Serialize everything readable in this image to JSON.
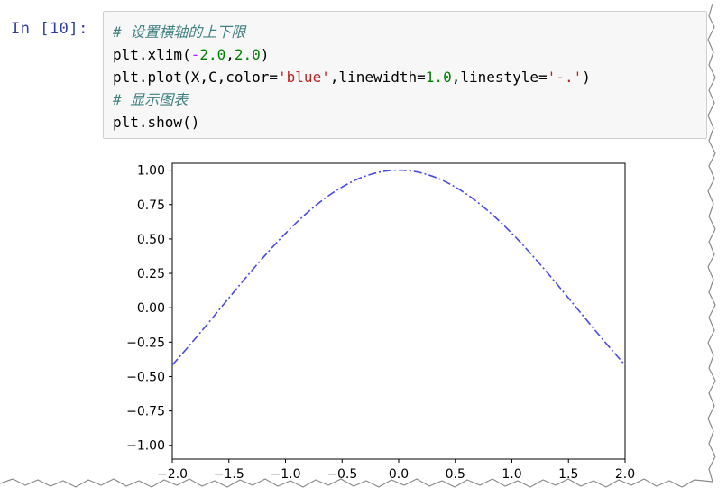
{
  "cell": {
    "prompt": "In  [10]:",
    "code_lines": [
      {
        "parts": [
          {
            "t": "# 设置横轴的上下限",
            "c": "cm"
          }
        ]
      },
      {
        "parts": [
          {
            "t": "plt.xlim(",
            "c": ""
          },
          {
            "t": "-",
            "c": "op"
          },
          {
            "t": "2.0",
            "c": "num"
          },
          {
            "t": ",",
            "c": ""
          },
          {
            "t": "2.0",
            "c": "num"
          },
          {
            "t": ")",
            "c": ""
          }
        ]
      },
      {
        "parts": [
          {
            "t": "plt.plot(X,C,color=",
            "c": ""
          },
          {
            "t": "'blue'",
            "c": "str"
          },
          {
            "t": ",linewidth=",
            "c": ""
          },
          {
            "t": "1.0",
            "c": "num"
          },
          {
            "t": ",linestyle=",
            "c": ""
          },
          {
            "t": "'-.'",
            "c": "str"
          },
          {
            "t": ")",
            "c": ""
          }
        ]
      },
      {
        "parts": [
          {
            "t": "# 显示图表",
            "c": "cm"
          }
        ]
      },
      {
        "parts": [
          {
            "t": "plt.show()",
            "c": ""
          }
        ]
      }
    ]
  },
  "chart_data": {
    "type": "line",
    "function": "cos",
    "x_range": [
      -2.0,
      2.0
    ],
    "xlim": [
      -2.0,
      2.0
    ],
    "ylim": [
      -1.1,
      1.05
    ],
    "x_ticks": [
      -2.0,
      -1.5,
      -1.0,
      -0.5,
      0.0,
      0.5,
      1.0,
      1.5,
      2.0
    ],
    "x_tick_labels": [
      "−2.0",
      "−1.5",
      "−1.0",
      "−0.5",
      "0.0",
      "0.5",
      "1.0",
      "1.5",
      "2.0"
    ],
    "y_ticks": [
      1.0,
      0.75,
      0.5,
      0.25,
      0.0,
      -0.25,
      -0.5,
      -0.75,
      -1.0
    ],
    "y_tick_labels": [
      "1.00",
      "0.75",
      "0.50",
      "0.25",
      "0.00",
      "−0.25",
      "−0.50",
      "−0.75",
      "−1.00"
    ],
    "series": [
      {
        "color": "#4a4ae8",
        "linestyle": "-.",
        "x": [
          -2.0,
          -1.5,
          -1.0,
          -0.5,
          0.0,
          0.5,
          1.0,
          1.5,
          2.0
        ],
        "y": [
          -0.416,
          0.071,
          0.54,
          0.878,
          1.0,
          0.878,
          0.54,
          0.071,
          -0.416
        ]
      }
    ],
    "title": "",
    "xlabel": "",
    "ylabel": "",
    "grid": false
  }
}
